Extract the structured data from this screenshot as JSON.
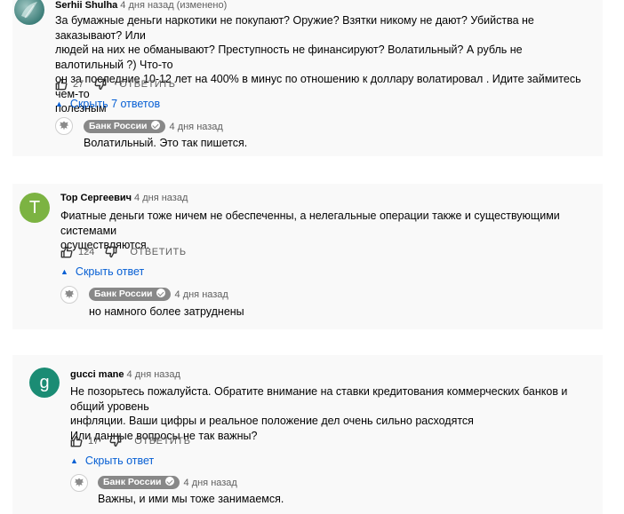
{
  "comments": [
    {
      "author": "Serhii Shulha",
      "time": "4 дня назад (изменено)",
      "lines": [
        "За бумажные деньги наркотики не покупают? Оружие? Взятки никому не дают? Убийства не заказывают? Или",
        "людей на них не обманывают? Преступность не финансируют? Волатильный? А рубль не валотильный ?) Что-то",
        "он за последние 10-12 лет на 400% в минус по отношению к доллару волатировал . Идите займитесь чем-то",
        "полезным"
      ],
      "likes": "27",
      "reply_label": "ОТВЕТИТЬ",
      "toggle_label": "Скрыть 7 ответов",
      "reply": {
        "author": "Банк России",
        "time": "4 дня назад",
        "text": "Волатильный. Это так пишется."
      }
    },
    {
      "author": "Тор Сергеевич",
      "time": "4 дня назад",
      "avatar_letter": "T",
      "avatar_color": "#7cb342",
      "lines": [
        "Фиатные деньги тоже ничем не обеспеченны, а нелегальные операции также и существующими системами",
        "осуществляются."
      ],
      "likes": "124",
      "reply_label": "ОТВЕТИТЬ",
      "toggle_label": "Скрыть ответ",
      "reply": {
        "author": "Банк России",
        "time": "4 дня назад",
        "text": "но намного более затруднены"
      }
    },
    {
      "author": "gucci mane",
      "time": "4 дня назад",
      "avatar_letter": "g",
      "avatar_color": "#1b8c74",
      "lines": [
        "Не позорьтесь пожалуйста. Обратите внимание на ставки кредитования коммерческих банков и общий уровень",
        "инфляции. Ваши цифры и реальное положение дел очень сильно расходятся",
        "Или данные вопросы не так важны?"
      ],
      "likes": "17",
      "reply_label": "ОТВЕТИТЬ",
      "toggle_label": "Скрыть ответ",
      "reply": {
        "author": "Банк России",
        "time": "4 дня назад",
        "text": "Важны, и ими мы тоже занимаемся."
      }
    }
  ]
}
